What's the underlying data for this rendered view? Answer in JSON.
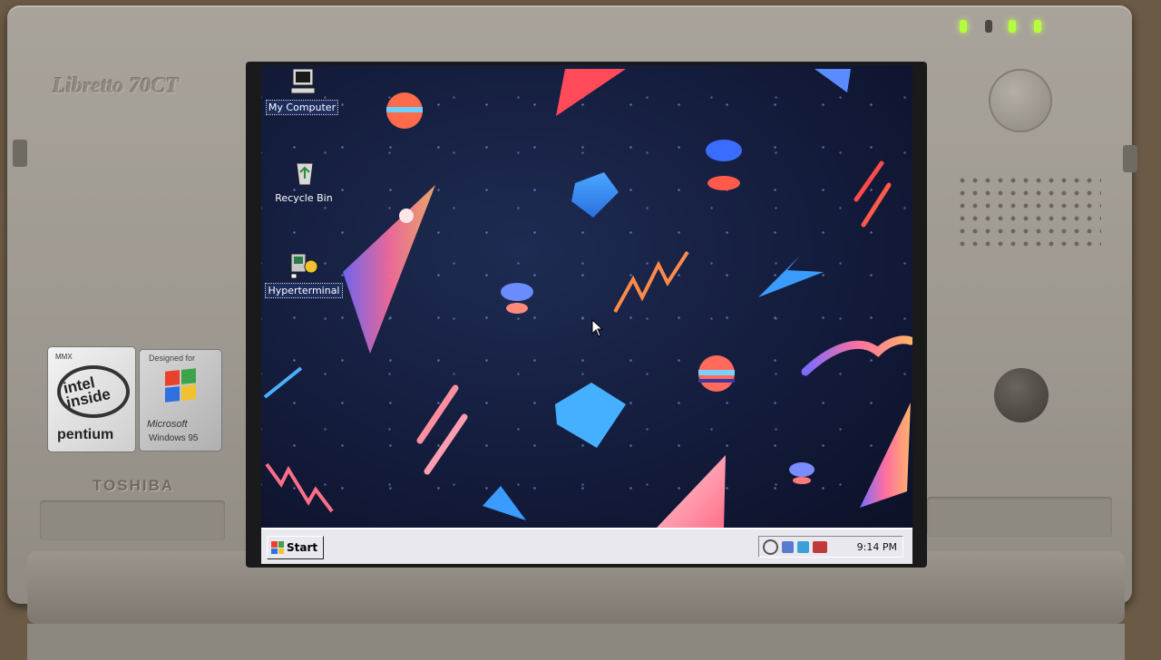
{
  "device": {
    "model": "Libretto 70CT",
    "maker": "TOSHIBA",
    "sticker_intel": {
      "mmx": "MMX",
      "inside": "intel inside",
      "brand": "pentium"
    },
    "sticker_windows": {
      "caption": "Designed for",
      "maker": "Microsoft",
      "product": "Windows 95"
    },
    "led_colors": {
      "on": "#b4ff3a",
      "off": "#4a4741"
    }
  },
  "desktop": {
    "icons": [
      {
        "label": "My Computer",
        "icon": "my-computer-icon",
        "selected": true
      },
      {
        "label": "Recycle Bin",
        "icon": "recycle-bin-icon",
        "selected": false
      },
      {
        "label": "Hyperterminal",
        "icon": "hyperterminal-icon",
        "selected": true
      }
    ]
  },
  "taskbar": {
    "start_label": "Start",
    "clock": "9:14 PM",
    "tray_icons": [
      "magnifier-icon",
      "display-icon",
      "network-icon",
      "battery-icon"
    ]
  },
  "colors": {
    "desktop_bg": "#141c3c",
    "taskbar_bg": "#e8e8ee",
    "win_red": "#e8412c",
    "win_green": "#3da34a",
    "win_blue": "#2f6fe0",
    "win_yellow": "#f2c12e"
  }
}
